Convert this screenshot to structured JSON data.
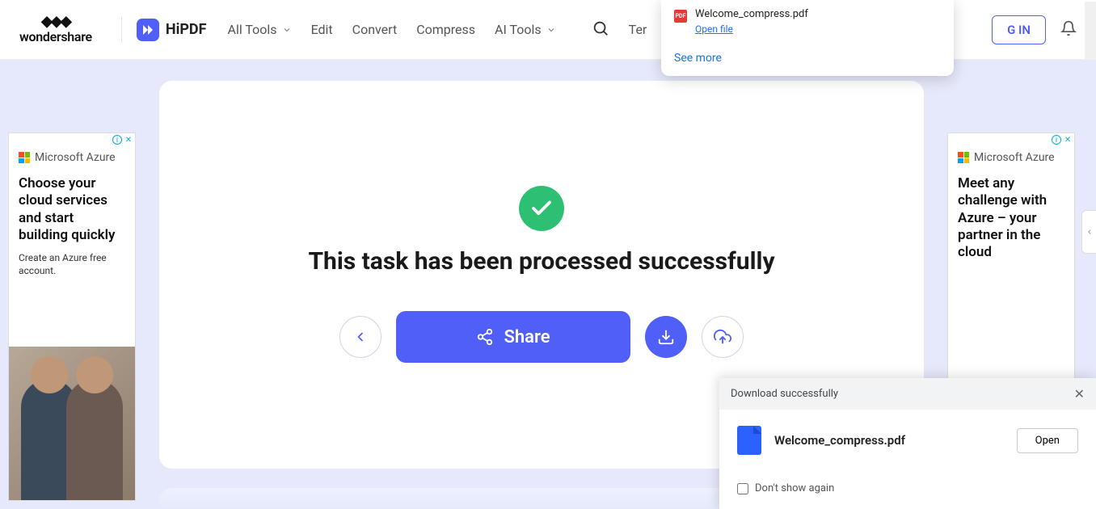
{
  "brand": {
    "name": "wondershare"
  },
  "product": {
    "name": "HiPDF"
  },
  "nav": {
    "all_tools": "All Tools",
    "edit": "Edit",
    "convert": "Convert",
    "compress": "Compress",
    "ai_tools": "AI Tools",
    "templates_prefix": "Ter"
  },
  "header": {
    "login": "G IN"
  },
  "browser_dl": {
    "filename": "Welcome_compress.pdf",
    "open": "Open file",
    "see_more": "See more"
  },
  "main": {
    "success_title": "This task has been processed successfully",
    "share": "Share"
  },
  "ad_left": {
    "brand": "Microsoft Azure",
    "headline": "Choose your cloud services and start building quickly",
    "sub": "Create an Azure free account."
  },
  "ad_right": {
    "brand": "Microsoft Azure",
    "headline": "Meet any challenge with Azure – your partner in the cloud"
  },
  "toast": {
    "title": "Download successfully",
    "filename": "Welcome_compress.pdf",
    "open": "Open",
    "dont_show": "Don't show again"
  }
}
